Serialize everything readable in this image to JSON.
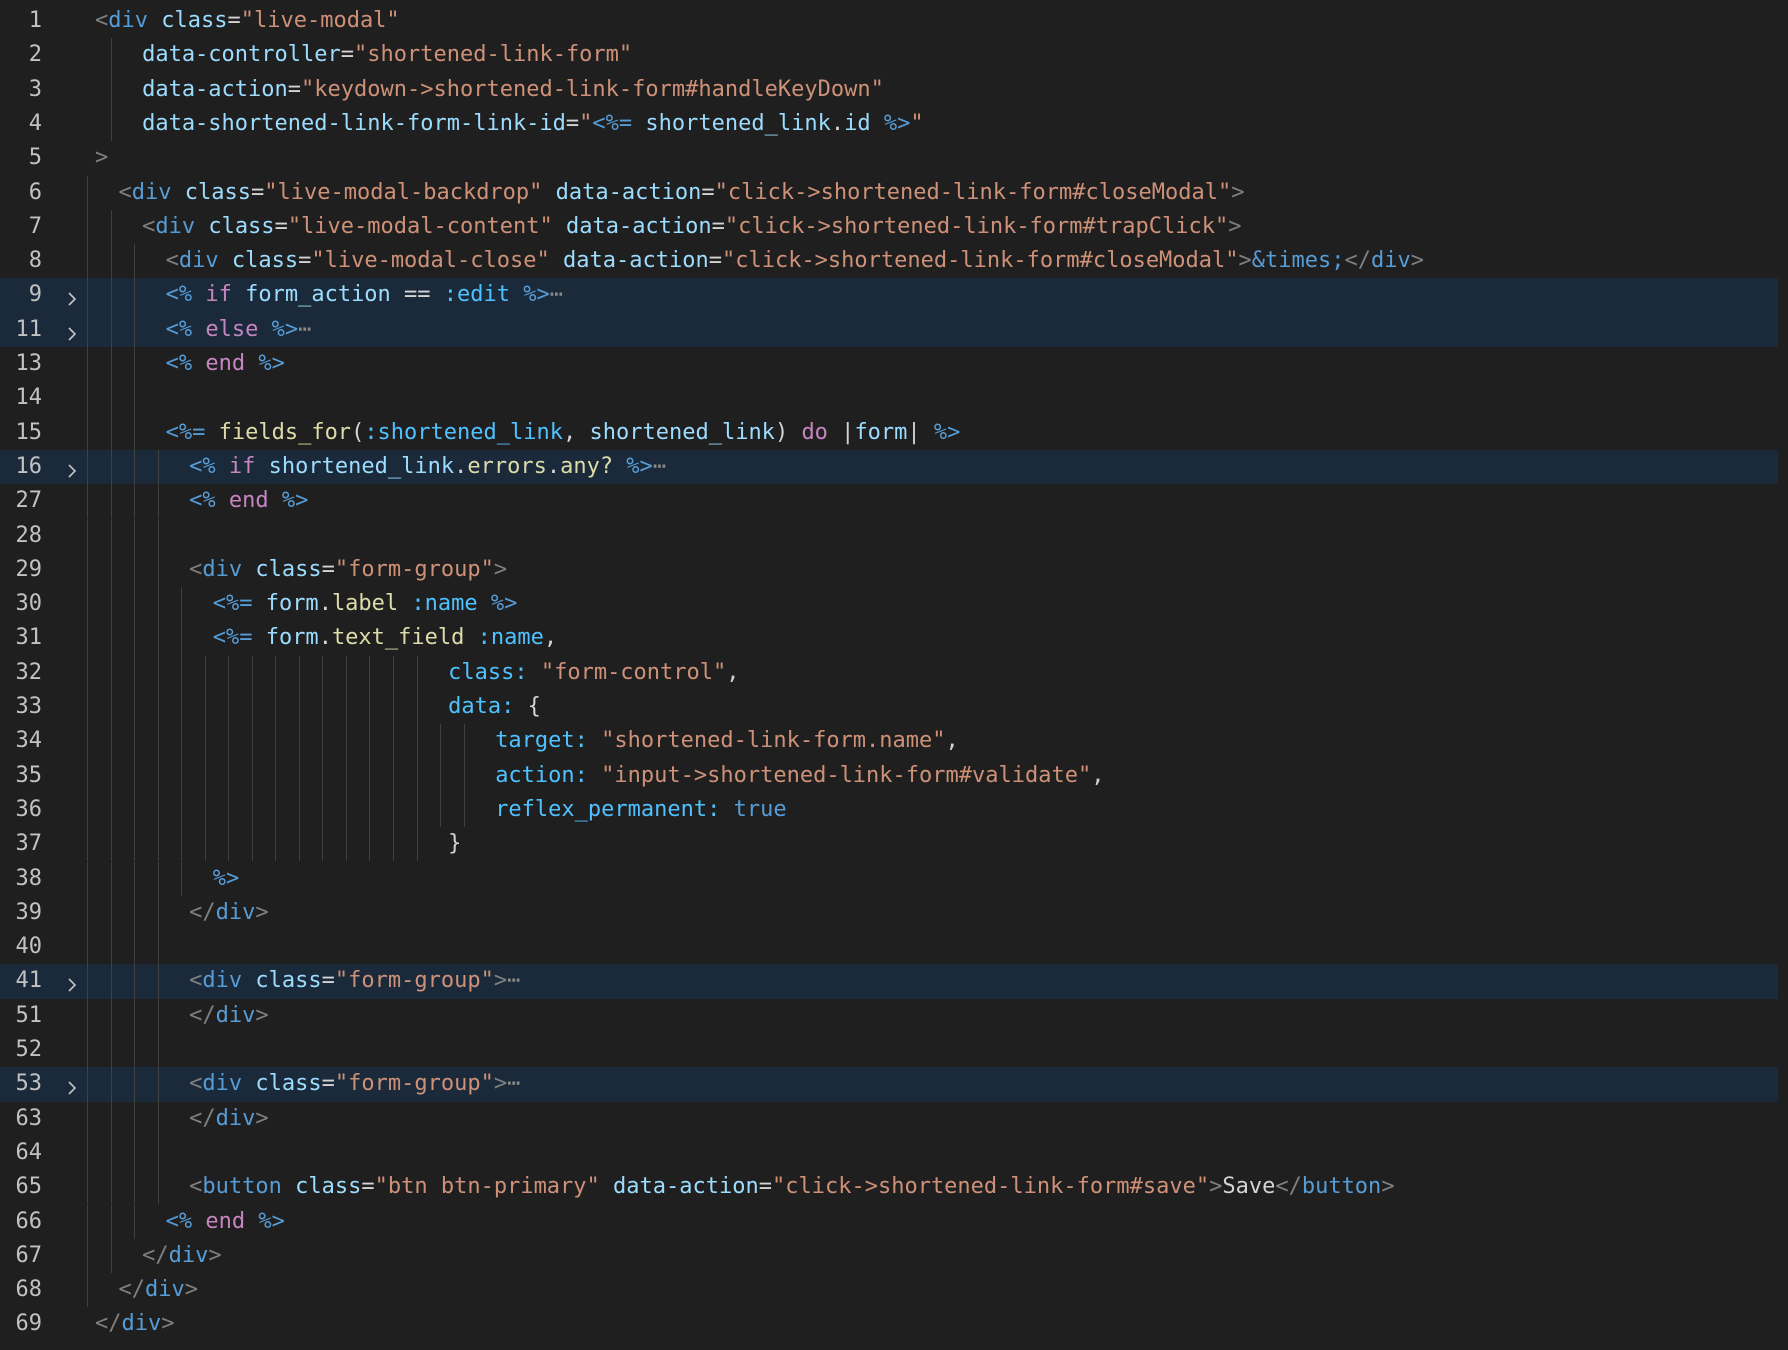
{
  "editor": {
    "lines": [
      {
        "n": "1",
        "indent": 0,
        "guides": [],
        "folded": false,
        "segs": [
          [
            "t",
            "<"
          ],
          [
            "tn",
            "div"
          ],
          [
            "at",
            " class"
          ],
          [
            "p",
            "="
          ],
          [
            "s",
            "\"live-modal\""
          ]
        ]
      },
      {
        "n": "2",
        "indent": 2,
        "guides": [
          1
        ],
        "folded": false,
        "segs": [
          [
            "at",
            "data-controller"
          ],
          [
            "p",
            "="
          ],
          [
            "s",
            "\"shortened-link-form\""
          ]
        ]
      },
      {
        "n": "3",
        "indent": 2,
        "guides": [
          1
        ],
        "folded": false,
        "segs": [
          [
            "at",
            "data-action"
          ],
          [
            "p",
            "="
          ],
          [
            "s",
            "\"keydown->shortened-link-form#handleKeyDown\""
          ]
        ]
      },
      {
        "n": "4",
        "indent": 2,
        "guides": [
          1
        ],
        "folded": false,
        "segs": [
          [
            "at",
            "data-shortened-link-form-link-id"
          ],
          [
            "p",
            "="
          ],
          [
            "s",
            "\""
          ],
          [
            "d",
            "<%="
          ],
          [
            "p",
            " "
          ],
          [
            "v",
            "shortened_link"
          ],
          [
            "p",
            "."
          ],
          [
            "v",
            "id"
          ],
          [
            "p",
            " "
          ],
          [
            "d",
            "%>"
          ],
          [
            "s",
            "\""
          ]
        ]
      },
      {
        "n": "5",
        "indent": 0,
        "guides": [],
        "folded": false,
        "segs": [
          [
            "t",
            ">"
          ]
        ]
      },
      {
        "n": "6",
        "indent": 1,
        "guides": [
          0
        ],
        "folded": false,
        "segs": [
          [
            "t",
            "<"
          ],
          [
            "tn",
            "div"
          ],
          [
            "at",
            " class"
          ],
          [
            "p",
            "="
          ],
          [
            "s",
            "\"live-modal-backdrop\""
          ],
          [
            "at",
            " data-action"
          ],
          [
            "p",
            "="
          ],
          [
            "s",
            "\"click->shortened-link-form#closeModal\""
          ],
          [
            "t",
            ">"
          ]
        ]
      },
      {
        "n": "7",
        "indent": 2,
        "guides": [
          0,
          1
        ],
        "folded": false,
        "segs": [
          [
            "t",
            "<"
          ],
          [
            "tn",
            "div"
          ],
          [
            "at",
            " class"
          ],
          [
            "p",
            "="
          ],
          [
            "s",
            "\"live-modal-content\""
          ],
          [
            "at",
            " data-action"
          ],
          [
            "p",
            "="
          ],
          [
            "s",
            "\"click->shortened-link-form#trapClick\""
          ],
          [
            "t",
            ">"
          ]
        ]
      },
      {
        "n": "8",
        "indent": 3,
        "guides": [
          0,
          1,
          2
        ],
        "folded": false,
        "segs": [
          [
            "t",
            "<"
          ],
          [
            "tn",
            "div"
          ],
          [
            "at",
            " class"
          ],
          [
            "p",
            "="
          ],
          [
            "s",
            "\"live-modal-close\""
          ],
          [
            "at",
            " data-action"
          ],
          [
            "p",
            "="
          ],
          [
            "s",
            "\"click->shortened-link-form#closeModal\""
          ],
          [
            "t",
            ">"
          ],
          [
            "e",
            "&times;"
          ],
          [
            "t",
            "</"
          ],
          [
            "tn",
            "div"
          ],
          [
            "t",
            ">"
          ]
        ]
      },
      {
        "n": "9",
        "indent": 3,
        "guides": [
          0,
          1,
          2
        ],
        "folded": true,
        "segs": [
          [
            "d",
            "<%"
          ],
          [
            "k",
            " if"
          ],
          [
            "v",
            " form_action"
          ],
          [
            "p",
            " == "
          ],
          [
            "sy",
            ":edit"
          ],
          [
            "d",
            " %>"
          ],
          [
            "dots",
            "⋯"
          ]
        ]
      },
      {
        "n": "11",
        "indent": 3,
        "guides": [
          0,
          1,
          2
        ],
        "folded": true,
        "segs": [
          [
            "d",
            "<%"
          ],
          [
            "k",
            " else"
          ],
          [
            "d",
            " %>"
          ],
          [
            "dots",
            "⋯"
          ]
        ]
      },
      {
        "n": "13",
        "indent": 3,
        "guides": [
          0,
          1,
          2
        ],
        "folded": false,
        "segs": [
          [
            "d",
            "<%"
          ],
          [
            "k",
            " end"
          ],
          [
            "d",
            " %>"
          ]
        ]
      },
      {
        "n": "14",
        "indent": 0,
        "guides": [
          0,
          1,
          2
        ],
        "folded": false,
        "segs": []
      },
      {
        "n": "15",
        "indent": 3,
        "guides": [
          0,
          1,
          2
        ],
        "folded": false,
        "segs": [
          [
            "d",
            "<%="
          ],
          [
            "m",
            " fields_for"
          ],
          [
            "p",
            "("
          ],
          [
            "sy",
            ":shortened_link"
          ],
          [
            "p",
            ", "
          ],
          [
            "v",
            "shortened_link"
          ],
          [
            "p",
            ") "
          ],
          [
            "k",
            "do"
          ],
          [
            "p",
            " |"
          ],
          [
            "v",
            "form"
          ],
          [
            "p",
            "| "
          ],
          [
            "d",
            "%>"
          ]
        ]
      },
      {
        "n": "16",
        "indent": 4,
        "guides": [
          0,
          1,
          2,
          3
        ],
        "folded": true,
        "segs": [
          [
            "d",
            "<%"
          ],
          [
            "k",
            " if"
          ],
          [
            "v",
            " shortened_link"
          ],
          [
            "p",
            "."
          ],
          [
            "m",
            "errors"
          ],
          [
            "p",
            "."
          ],
          [
            "m",
            "any?"
          ],
          [
            "d",
            " %>"
          ],
          [
            "dots",
            "⋯"
          ]
        ]
      },
      {
        "n": "27",
        "indent": 4,
        "guides": [
          0,
          1,
          2,
          3
        ],
        "folded": false,
        "segs": [
          [
            "d",
            "<%"
          ],
          [
            "k",
            " end"
          ],
          [
            "d",
            " %>"
          ]
        ]
      },
      {
        "n": "28",
        "indent": 0,
        "guides": [
          0,
          1,
          2,
          3
        ],
        "folded": false,
        "segs": []
      },
      {
        "n": "29",
        "indent": 4,
        "guides": [
          0,
          1,
          2,
          3
        ],
        "folded": false,
        "segs": [
          [
            "t",
            "<"
          ],
          [
            "tn",
            "div"
          ],
          [
            "at",
            " class"
          ],
          [
            "p",
            "="
          ],
          [
            "s",
            "\"form-group\""
          ],
          [
            "t",
            ">"
          ]
        ]
      },
      {
        "n": "30",
        "indent": 5,
        "guides": [
          0,
          1,
          2,
          3,
          4
        ],
        "folded": false,
        "segs": [
          [
            "d",
            "<%="
          ],
          [
            "v",
            " form"
          ],
          [
            "p",
            "."
          ],
          [
            "m",
            "label"
          ],
          [
            "sy",
            " :name"
          ],
          [
            "d",
            " %>"
          ]
        ]
      },
      {
        "n": "31",
        "indent": 5,
        "guides": [
          0,
          1,
          2,
          3,
          4
        ],
        "folded": false,
        "segs": [
          [
            "d",
            "<%="
          ],
          [
            "v",
            " form"
          ],
          [
            "p",
            "."
          ],
          [
            "m",
            "text_field"
          ],
          [
            "sy",
            " :name"
          ],
          [
            "p",
            ","
          ]
        ]
      },
      {
        "n": "32",
        "indent": 15,
        "guides": [
          0,
          1,
          2,
          3,
          4,
          5,
          6,
          7,
          8,
          9,
          10,
          11,
          12,
          13,
          14
        ],
        "folded": false,
        "segs": [
          [
            "sy",
            "class:"
          ],
          [
            "s",
            " \"form-control\""
          ],
          [
            "p",
            ","
          ]
        ]
      },
      {
        "n": "33",
        "indent": 15,
        "guides": [
          0,
          1,
          2,
          3,
          4,
          5,
          6,
          7,
          8,
          9,
          10,
          11,
          12,
          13,
          14
        ],
        "folded": false,
        "segs": [
          [
            "sy",
            "data:"
          ],
          [
            "p",
            " {"
          ]
        ]
      },
      {
        "n": "34",
        "indent": 17,
        "guides": [
          0,
          1,
          2,
          3,
          4,
          5,
          6,
          7,
          8,
          9,
          10,
          11,
          12,
          13,
          14,
          15,
          16
        ],
        "folded": false,
        "segs": [
          [
            "sy",
            "target:"
          ],
          [
            "s",
            " \"shortened-link-form.name\""
          ],
          [
            "p",
            ","
          ]
        ]
      },
      {
        "n": "35",
        "indent": 17,
        "guides": [
          0,
          1,
          2,
          3,
          4,
          5,
          6,
          7,
          8,
          9,
          10,
          11,
          12,
          13,
          14,
          15,
          16
        ],
        "folded": false,
        "segs": [
          [
            "sy",
            "action:"
          ],
          [
            "s",
            " \"input->shortened-link-form#validate\""
          ],
          [
            "p",
            ","
          ]
        ]
      },
      {
        "n": "36",
        "indent": 17,
        "guides": [
          0,
          1,
          2,
          3,
          4,
          5,
          6,
          7,
          8,
          9,
          10,
          11,
          12,
          13,
          14,
          15,
          16
        ],
        "folded": false,
        "segs": [
          [
            "sy",
            "reflex_permanent:"
          ],
          [
            "tn",
            " true"
          ]
        ]
      },
      {
        "n": "37",
        "indent": 15,
        "guides": [
          0,
          1,
          2,
          3,
          4,
          5,
          6,
          7,
          8,
          9,
          10,
          11,
          12,
          13,
          14
        ],
        "folded": false,
        "segs": [
          [
            "p",
            "}"
          ]
        ]
      },
      {
        "n": "38",
        "indent": 5,
        "guides": [
          0,
          1,
          2,
          3,
          4
        ],
        "folded": false,
        "segs": [
          [
            "d",
            "%>"
          ]
        ]
      },
      {
        "n": "39",
        "indent": 4,
        "guides": [
          0,
          1,
          2,
          3
        ],
        "folded": false,
        "segs": [
          [
            "t",
            "</"
          ],
          [
            "tn",
            "div"
          ],
          [
            "t",
            ">"
          ]
        ]
      },
      {
        "n": "40",
        "indent": 0,
        "guides": [
          0,
          1,
          2,
          3
        ],
        "folded": false,
        "segs": []
      },
      {
        "n": "41",
        "indent": 4,
        "guides": [
          0,
          1,
          2,
          3
        ],
        "folded": true,
        "segs": [
          [
            "t",
            "<"
          ],
          [
            "tn",
            "div"
          ],
          [
            "at",
            " class"
          ],
          [
            "p",
            "="
          ],
          [
            "s",
            "\"form-group\""
          ],
          [
            "t",
            ">"
          ],
          [
            "dots",
            "⋯"
          ]
        ]
      },
      {
        "n": "51",
        "indent": 4,
        "guides": [
          0,
          1,
          2,
          3
        ],
        "folded": false,
        "segs": [
          [
            "t",
            "</"
          ],
          [
            "tn",
            "div"
          ],
          [
            "t",
            ">"
          ]
        ]
      },
      {
        "n": "52",
        "indent": 0,
        "guides": [
          0,
          1,
          2,
          3
        ],
        "folded": false,
        "segs": []
      },
      {
        "n": "53",
        "indent": 4,
        "guides": [
          0,
          1,
          2,
          3
        ],
        "folded": true,
        "segs": [
          [
            "t",
            "<"
          ],
          [
            "tn",
            "div"
          ],
          [
            "at",
            " class"
          ],
          [
            "p",
            "="
          ],
          [
            "s",
            "\"form-group\""
          ],
          [
            "t",
            ">"
          ],
          [
            "dots",
            "⋯"
          ]
        ]
      },
      {
        "n": "63",
        "indent": 4,
        "guides": [
          0,
          1,
          2,
          3
        ],
        "folded": false,
        "segs": [
          [
            "t",
            "</"
          ],
          [
            "tn",
            "div"
          ],
          [
            "t",
            ">"
          ]
        ]
      },
      {
        "n": "64",
        "indent": 0,
        "guides": [
          0,
          1,
          2,
          3
        ],
        "folded": false,
        "segs": []
      },
      {
        "n": "65",
        "indent": 4,
        "guides": [
          0,
          1,
          2,
          3
        ],
        "folded": false,
        "segs": [
          [
            "t",
            "<"
          ],
          [
            "tn",
            "button"
          ],
          [
            "at",
            " class"
          ],
          [
            "p",
            "="
          ],
          [
            "s",
            "\"btn btn-primary\""
          ],
          [
            "at",
            " data-action"
          ],
          [
            "p",
            "="
          ],
          [
            "s",
            "\"click->shortened-link-form#save\""
          ],
          [
            "t",
            ">"
          ],
          [
            "p",
            "Save"
          ],
          [
            "t",
            "</"
          ],
          [
            "tn",
            "button"
          ],
          [
            "t",
            ">"
          ]
        ]
      },
      {
        "n": "66",
        "indent": 3,
        "guides": [
          0,
          1,
          2
        ],
        "folded": false,
        "segs": [
          [
            "d",
            "<%"
          ],
          [
            "k",
            " end"
          ],
          [
            "d",
            " %>"
          ]
        ]
      },
      {
        "n": "67",
        "indent": 2,
        "guides": [
          0,
          1
        ],
        "folded": false,
        "segs": [
          [
            "t",
            "</"
          ],
          [
            "tn",
            "div"
          ],
          [
            "t",
            ">"
          ]
        ]
      },
      {
        "n": "68",
        "indent": 1,
        "guides": [
          0
        ],
        "folded": false,
        "segs": [
          [
            "t",
            "</"
          ],
          [
            "tn",
            "div"
          ],
          [
            "t",
            ">"
          ]
        ]
      },
      {
        "n": "69",
        "indent": 0,
        "guides": [],
        "folded": false,
        "segs": [
          [
            "t",
            "</"
          ],
          [
            "tn",
            "div"
          ],
          [
            "t",
            ">"
          ]
        ]
      }
    ]
  }
}
